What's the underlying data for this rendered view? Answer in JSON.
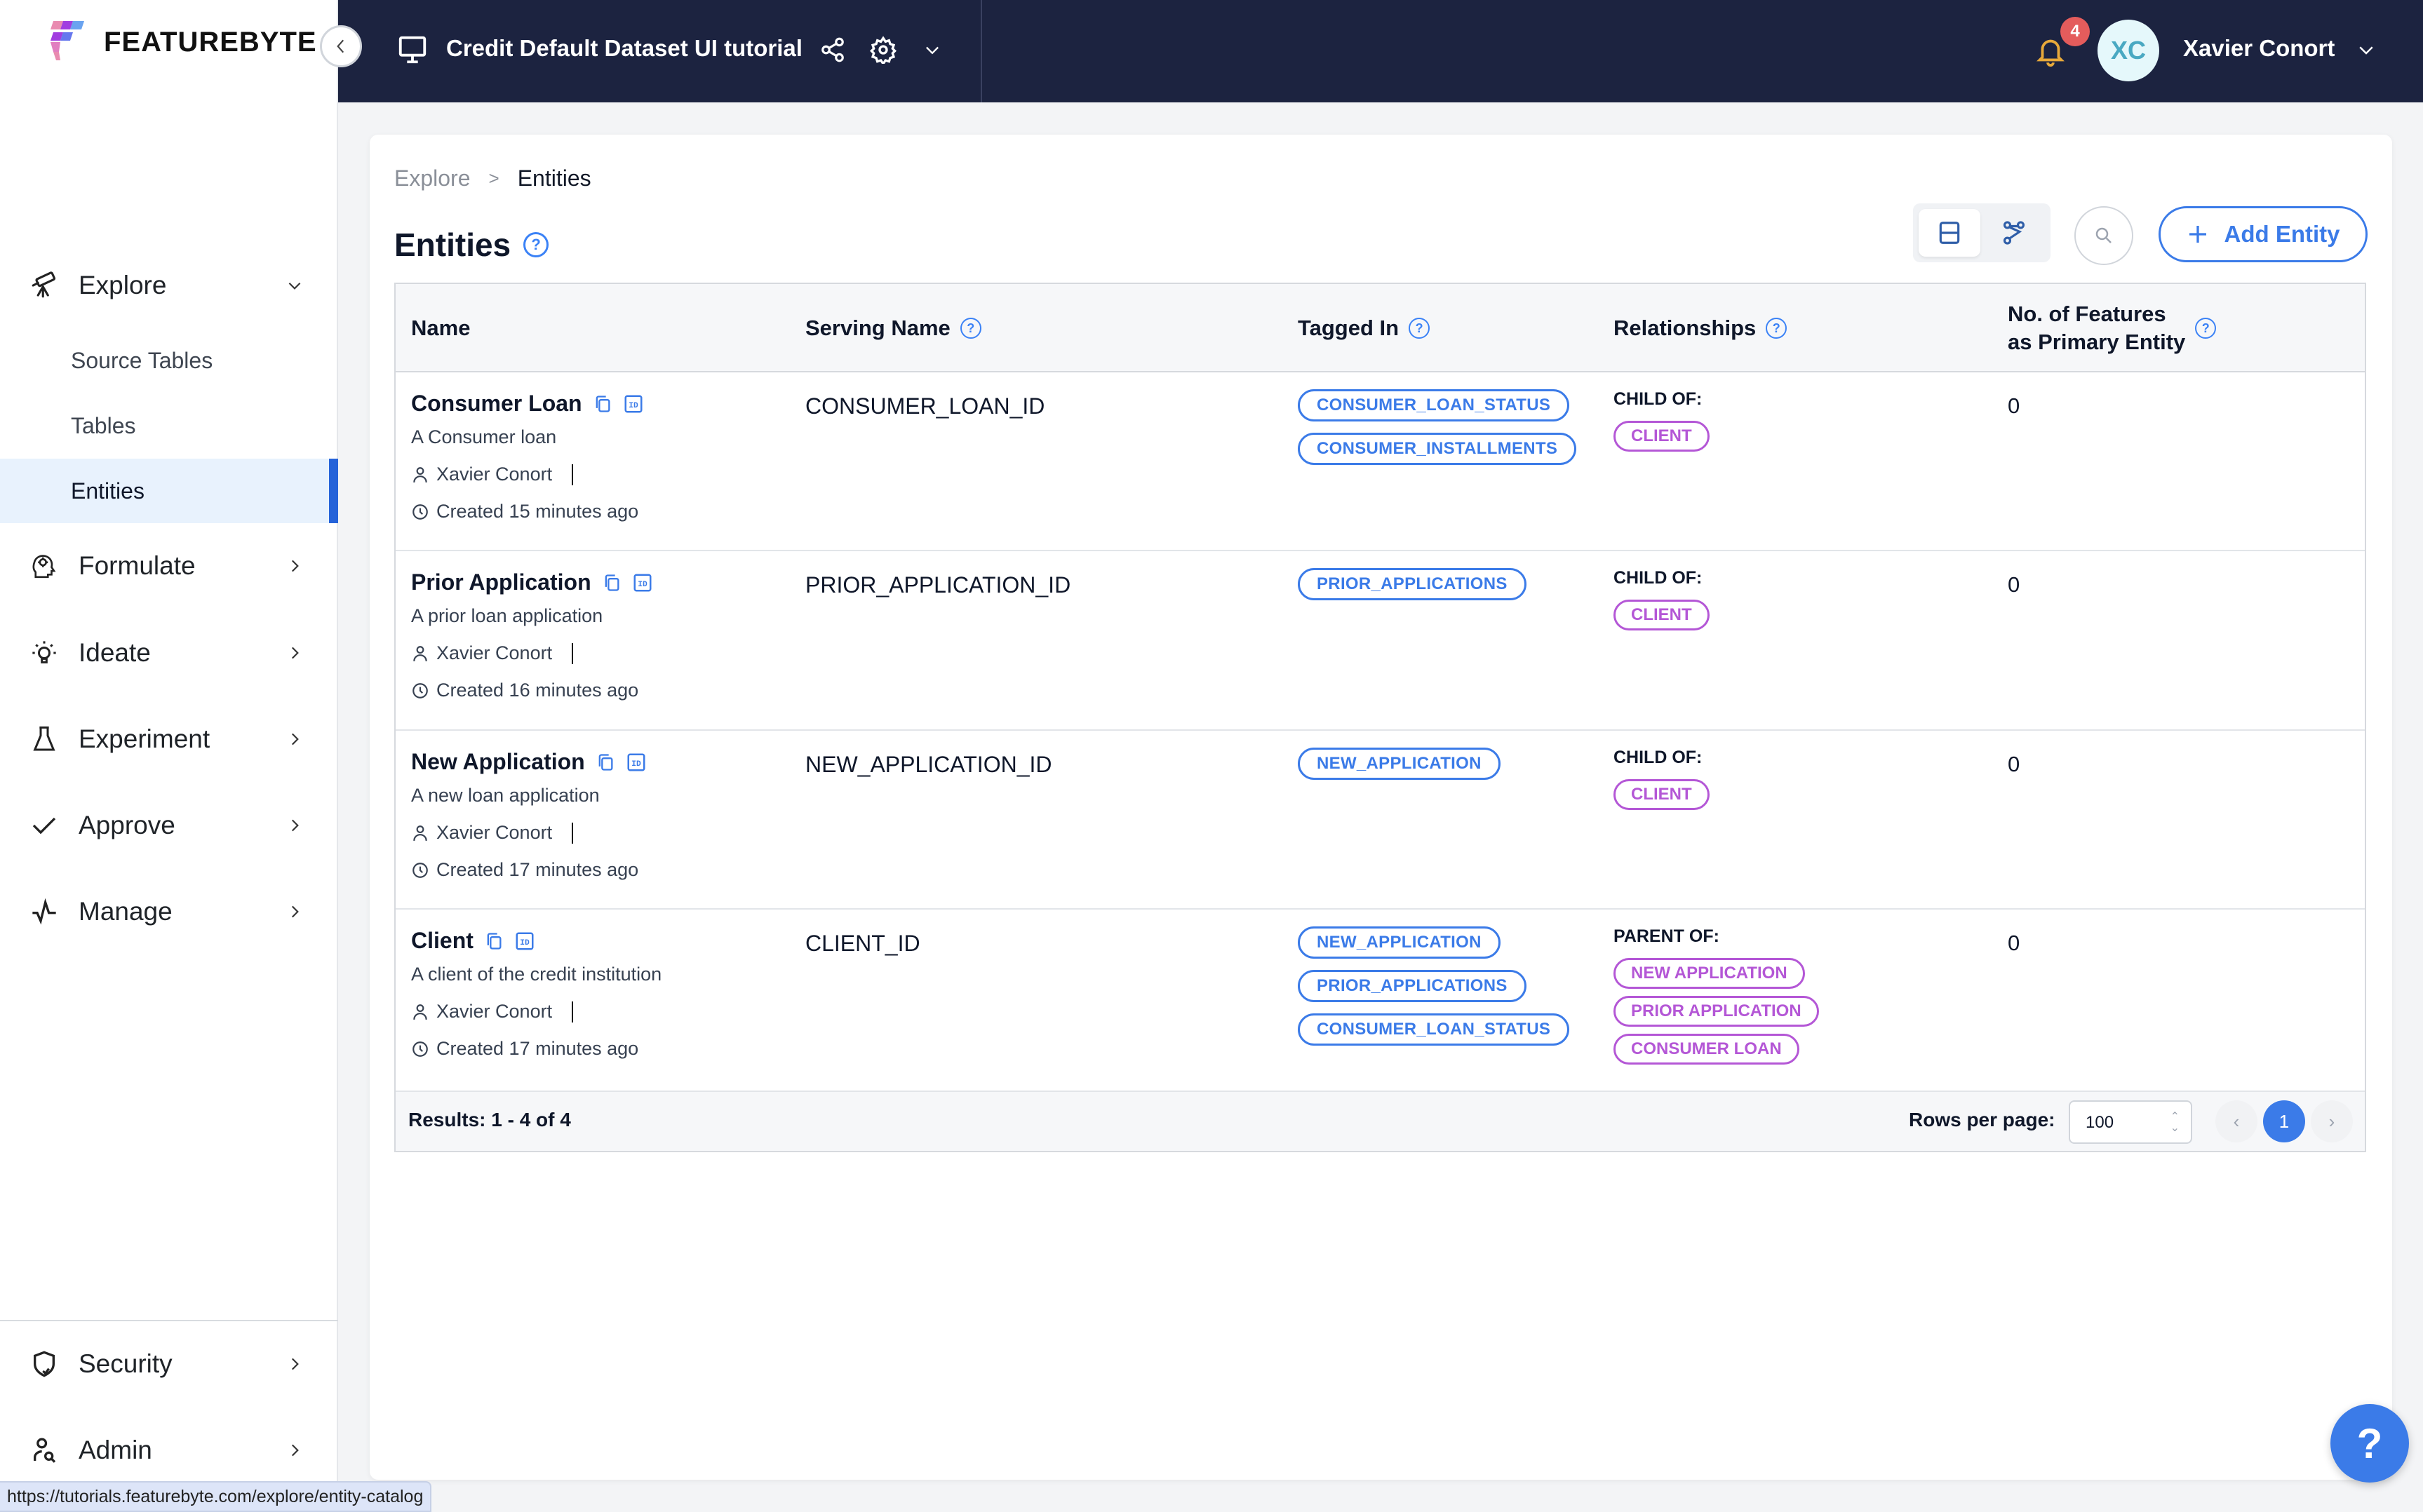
{
  "app": {
    "logo_text": "FEATUREBYTE",
    "project_title": "Credit Default Dataset UI tutorial",
    "notifications_count": "4",
    "user_initials": "XC",
    "user_name": "Xavier Conort"
  },
  "sidebar": {
    "explore": {
      "label": "Explore",
      "subitems": [
        "Source Tables",
        "Tables",
        "Entities"
      ],
      "active": "Entities"
    },
    "items": [
      {
        "label": "Formulate",
        "icon": "head-gear-icon"
      },
      {
        "label": "Ideate",
        "icon": "lightbulb-icon"
      },
      {
        "label": "Experiment",
        "icon": "flask-icon"
      },
      {
        "label": "Approve",
        "icon": "check-icon"
      },
      {
        "label": "Manage",
        "icon": "pulse-icon"
      }
    ],
    "bottom_items": [
      {
        "label": "Security",
        "icon": "shield-check-icon"
      },
      {
        "label": "Admin",
        "icon": "user-search-icon"
      }
    ]
  },
  "breadcrumb": {
    "parent": "Explore",
    "separator": ">",
    "current": "Entities"
  },
  "page": {
    "title": "Entities",
    "add_button": "Add Entity"
  },
  "table": {
    "columns": {
      "name": "Name",
      "serving_name": "Serving Name",
      "tagged_in": "Tagged In",
      "relationships": "Relationships",
      "features_line1": "No. of Features",
      "features_line2": "as Primary Entity"
    },
    "rows": [
      {
        "name": "Consumer Loan",
        "description": "A Consumer loan",
        "owner": "Xavier Conort",
        "created": "Created 15 minutes ago",
        "serving_name": "CONSUMER_LOAN_ID",
        "tags": [
          "CONSUMER_LOAN_STATUS",
          "CONSUMER_INSTALLMENTS"
        ],
        "relationship_type": "CHILD OF:",
        "relationships": [
          "CLIENT"
        ],
        "features_count": "0"
      },
      {
        "name": "Prior Application",
        "description": "A prior loan application",
        "owner": "Xavier Conort",
        "created": "Created 16 minutes ago",
        "serving_name": "PRIOR_APPLICATION_ID",
        "tags": [
          "PRIOR_APPLICATIONS"
        ],
        "relationship_type": "CHILD OF:",
        "relationships": [
          "CLIENT"
        ],
        "features_count": "0"
      },
      {
        "name": "New Application",
        "description": "A new loan application",
        "owner": "Xavier Conort",
        "created": "Created 17 minutes ago",
        "serving_name": "NEW_APPLICATION_ID",
        "tags": [
          "NEW_APPLICATION"
        ],
        "relationship_type": "CHILD OF:",
        "relationships": [
          "CLIENT"
        ],
        "features_count": "0"
      },
      {
        "name": "Client",
        "description": "A client of the credit institution",
        "owner": "Xavier Conort",
        "created": "Created 17 minutes ago",
        "serving_name": "CLIENT_ID",
        "tags": [
          "NEW_APPLICATION",
          "PRIOR_APPLICATIONS",
          "CONSUMER_LOAN_STATUS"
        ],
        "relationship_type": "PARENT OF:",
        "relationships": [
          "NEW APPLICATION",
          "PRIOR APPLICATION",
          "CONSUMER LOAN"
        ],
        "features_count": "0"
      }
    ],
    "footer": {
      "results": "Results: 1 - 4 of 4",
      "rows_per_page_label": "Rows per page:",
      "rows_per_page_value": "100",
      "current_page": "1"
    }
  },
  "status_bar_url": "https://tutorials.featurebyte.com/explore/entity-catalog",
  "colors": {
    "topbar": "#1c2340",
    "accent": "#3b7be8",
    "relationship_tag": "#b457d6",
    "active_nav_bg": "#e8f2fd",
    "notification_badge": "#e45c5c",
    "bell": "#e8a93a"
  }
}
